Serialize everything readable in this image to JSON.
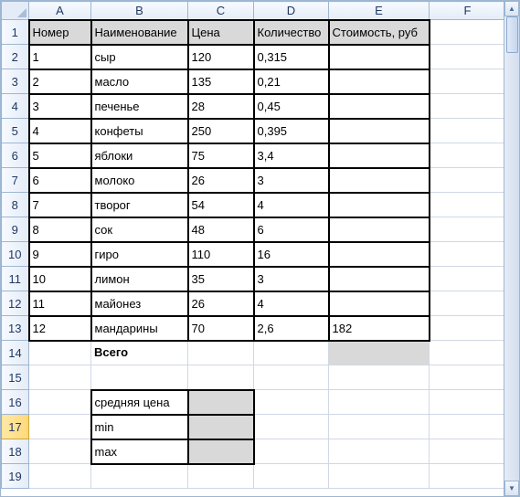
{
  "columns": [
    "A",
    "B",
    "C",
    "D",
    "E",
    "F"
  ],
  "headers": {
    "A": "Номер",
    "B": "Наименование",
    "C": "Цена",
    "D": "Количество",
    "E": "Стоимость, руб"
  },
  "rows": [
    {
      "n": "1",
      "name": "сыр",
      "price": "120",
      "qty": "0,315",
      "cost": ""
    },
    {
      "n": "2",
      "name": "масло",
      "price": "135",
      "qty": "0,21",
      "cost": ""
    },
    {
      "n": "3",
      "name": "печенье",
      "price": "28",
      "qty": "0,45",
      "cost": ""
    },
    {
      "n": "4",
      "name": "конфеты",
      "price": "250",
      "qty": "0,395",
      "cost": ""
    },
    {
      "n": "5",
      "name": "яблоки",
      "price": "75",
      "qty": "3,4",
      "cost": ""
    },
    {
      "n": "6",
      "name": "молоко",
      "price": "26",
      "qty": "3",
      "cost": ""
    },
    {
      "n": "7",
      "name": "творог",
      "price": "54",
      "qty": "4",
      "cost": ""
    },
    {
      "n": "8",
      "name": "сок",
      "price": "48",
      "qty": "6",
      "cost": ""
    },
    {
      "n": "9",
      "name": "гиро",
      "price": "110",
      "qty": "16",
      "cost": ""
    },
    {
      "n": "10",
      "name": "лимон",
      "price": "35",
      "qty": "3",
      "cost": ""
    },
    {
      "n": "11",
      "name": "майонез",
      "price": "26",
      "qty": "4",
      "cost": ""
    },
    {
      "n": "12",
      "name": "мандарины",
      "price": "70",
      "qty": "2,6",
      "cost": "182"
    }
  ],
  "total_label": "Всего",
  "stats": {
    "avg": "средняя цена",
    "min": "min",
    "max": "max"
  },
  "selected_row": "17",
  "chart_data": {
    "type": "table",
    "columns": [
      "Номер",
      "Наименование",
      "Цена",
      "Количество",
      "Стоимость, руб"
    ],
    "data": [
      [
        1,
        "сыр",
        120,
        0.315,
        null
      ],
      [
        2,
        "масло",
        135,
        0.21,
        null
      ],
      [
        3,
        "печенье",
        28,
        0.45,
        null
      ],
      [
        4,
        "конфеты",
        250,
        0.395,
        null
      ],
      [
        5,
        "яблоки",
        75,
        3.4,
        null
      ],
      [
        6,
        "молоко",
        26,
        3,
        null
      ],
      [
        7,
        "творог",
        54,
        4,
        null
      ],
      [
        8,
        "сок",
        48,
        6,
        null
      ],
      [
        9,
        "гиро",
        110,
        16,
        null
      ],
      [
        10,
        "лимон",
        35,
        3,
        null
      ],
      [
        11,
        "майонез",
        26,
        4,
        null
      ],
      [
        12,
        "мандарины",
        70,
        2.6,
        182
      ]
    ]
  }
}
